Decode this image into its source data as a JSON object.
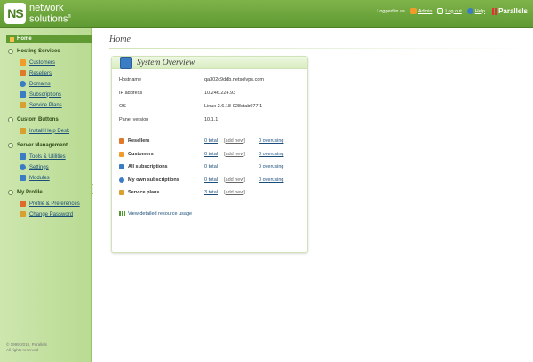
{
  "header": {
    "logo_mark": "NS",
    "logo_line1": "network",
    "logo_line2": "solutions",
    "logo_tm": "®",
    "logged_in_as": "Logged in as",
    "user_name": "Admin",
    "logout_label": "Log out",
    "help_label": "Help",
    "brand": "Parallels"
  },
  "sidebar": {
    "home": "Home",
    "groups": [
      {
        "label": "Hosting Services",
        "items": [
          {
            "label": "Customers",
            "icon": "customers-icon",
            "color": "#f09b2a"
          },
          {
            "label": "Resellers",
            "icon": "resellers-icon",
            "color": "#e07a2a"
          },
          {
            "label": "Domains",
            "icon": "domains-icon",
            "color": "#3b7cc4"
          },
          {
            "label": "Subscriptions",
            "icon": "subscriptions-icon",
            "color": "#3b7cc4"
          },
          {
            "label": "Service Plans",
            "icon": "service-plans-icon",
            "color": "#d9a030"
          }
        ]
      },
      {
        "label": "Custom Buttons",
        "items": [
          {
            "label": "Install Help Desk",
            "icon": "help-desk-icon",
            "color": "#d9a030"
          }
        ]
      },
      {
        "label": "Server Management",
        "items": [
          {
            "label": "Tools & Utilities",
            "icon": "tools-icon",
            "color": "#3b7cc4"
          },
          {
            "label": "Settings",
            "icon": "settings-icon",
            "color": "#3b7cc4"
          },
          {
            "label": "Modules",
            "icon": "modules-icon",
            "color": "#3b7cc4"
          }
        ]
      },
      {
        "label": "My Profile",
        "items": [
          {
            "label": "Profile & Preferences",
            "icon": "profile-icon",
            "color": "#e06a2a"
          },
          {
            "label": "Change Password",
            "icon": "password-icon",
            "color": "#d9a030"
          }
        ]
      }
    ],
    "copyright_line1": "© 1999-2010, Parallels",
    "copyright_line2": "All rights reserved",
    "collapse_glyph": "‹"
  },
  "main": {
    "page_title": "Home",
    "panel_title": "System Overview",
    "info": [
      {
        "label": "Hostname",
        "value": "qa302c9ddb.netsolvps.com"
      },
      {
        "label": "IP address",
        "value": "10.246.224.93"
      },
      {
        "label": "OS",
        "value": "Linux 2.6.18-028stab077.1"
      },
      {
        "label": "Panel version",
        "value": "10.1.1"
      }
    ],
    "resources": [
      {
        "name": "Resellers",
        "total": "0 total",
        "add": "add new",
        "over": "0 overusing",
        "color": "#e07a2a"
      },
      {
        "name": "Customers",
        "total": "0 total",
        "add": "add new",
        "over": "0 overusing",
        "color": "#f09b2a"
      },
      {
        "name": "All subscriptions",
        "total": "0 total",
        "add": "",
        "over": "0 overusing",
        "color": "#3b7cc4"
      },
      {
        "name": "My own subscriptions",
        "total": "0 total",
        "add": "add new",
        "over": "0 overusing",
        "color": "#3b7cc4"
      },
      {
        "name": "Service plans",
        "total": "3 total",
        "add": "add new",
        "over": "",
        "color": "#d9a030"
      }
    ],
    "usage_link": "View detailed resource usage"
  }
}
